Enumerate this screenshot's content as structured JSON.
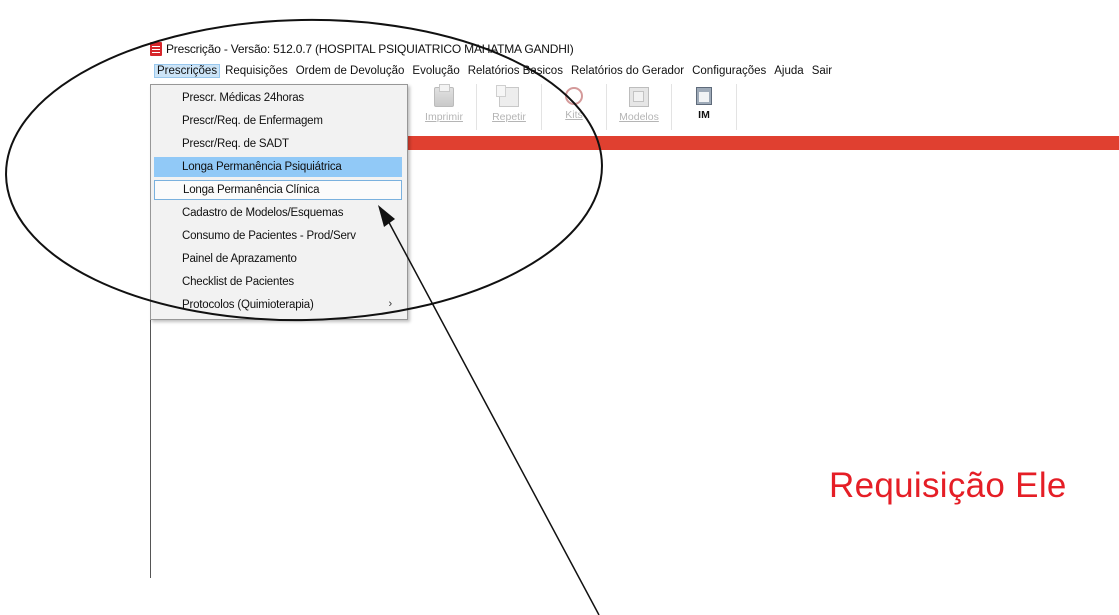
{
  "window": {
    "title": "Prescrição - Versão: 512.0.7 (HOSPITAL PSIQUIATRICO MAHATMA GANDHI)",
    "icon": "document-icon"
  },
  "menubar": {
    "items": [
      {
        "label": "Prescrições"
      },
      {
        "label": "Requisições"
      },
      {
        "label": "Ordem de Devolução"
      },
      {
        "label": "Evolução"
      },
      {
        "label": "Relatórios Basicos"
      },
      {
        "label": "Relatórios do Gerador"
      },
      {
        "label": "Configurações"
      },
      {
        "label": "Ajuda"
      },
      {
        "label": "Sair"
      }
    ]
  },
  "toolbar": {
    "items": [
      {
        "label": "Imprimir",
        "icon": "printer-icon",
        "enabled": false
      },
      {
        "label": "Repetir",
        "icon": "repeat-icon",
        "enabled": false
      },
      {
        "label": "Kits",
        "icon": "kits-icon",
        "enabled": false
      },
      {
        "label": "Modelos",
        "icon": "models-icon",
        "enabled": false
      },
      {
        "label": "IM",
        "icon": "im-icon",
        "enabled": true
      }
    ]
  },
  "dropdown": {
    "items": [
      {
        "label": "Prescr. Médicas 24horas"
      },
      {
        "label": "Prescr/Req. de Enfermagem"
      },
      {
        "label": "Prescr/Req. de SADT"
      },
      {
        "label": "Longa Permanência Psiquiátrica",
        "state": "highlighted"
      },
      {
        "label": "Longa Permanência Clínica",
        "state": "focused"
      },
      {
        "label": "Cadastro de Modelos/Esquemas"
      },
      {
        "label": "Consumo de Pacientes - Prod/Serv"
      },
      {
        "label": "Painel de Aprazamento"
      },
      {
        "label": "Checklist de Pacientes"
      },
      {
        "label": "Protocolos (Quimioterapia)",
        "submenu_arrow": "›"
      }
    ]
  },
  "main": {
    "heading": "Requisição Ele"
  },
  "colors": {
    "accent_red": "#e51e26",
    "band_red": "#e04030",
    "menu_highlight": "#91c9f7"
  }
}
